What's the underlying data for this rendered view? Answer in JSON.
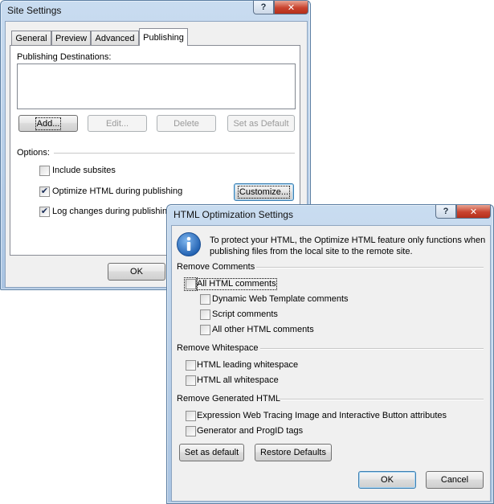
{
  "site_settings": {
    "title": "Site Settings",
    "help_glyph": "?",
    "close_glyph": "✕",
    "tabs": [
      "General",
      "Preview",
      "Advanced",
      "Publishing"
    ],
    "active_tab": "Publishing",
    "publishing_destinations_label": "Publishing Destinations:",
    "buttons": {
      "add": "Add...",
      "edit": "Edit...",
      "delete": "Delete",
      "set_as_default": "Set as Default"
    },
    "options_label": "Options:",
    "options": [
      {
        "label": "Include subsites",
        "checked": false
      },
      {
        "label": "Optimize HTML during publishing",
        "checked": true
      },
      {
        "label": "Log changes during publishing",
        "checked": true
      }
    ],
    "customize_label": "Customize...",
    "ok_label": "OK"
  },
  "html_opt": {
    "title": "HTML Optimization Settings",
    "help_glyph": "?",
    "close_glyph": "✕",
    "info_icon": "info-icon",
    "info_text_line1": "To protect your HTML, the Optimize HTML feature only functions when",
    "info_text_line2": "publishing files from the local site to the remote site.",
    "remove_comments_label": "Remove Comments",
    "comments": {
      "all": {
        "label": "All HTML comments",
        "checked": false
      },
      "dwt": {
        "label": "Dynamic Web Template comments",
        "checked": false
      },
      "script": {
        "label": "Script comments",
        "checked": false
      },
      "other": {
        "label": "All other HTML comments",
        "checked": false
      }
    },
    "remove_whitespace_label": "Remove Whitespace",
    "whitespace": {
      "leading": {
        "label": "HTML leading whitespace",
        "checked": false
      },
      "all": {
        "label": "HTML all whitespace",
        "checked": false
      }
    },
    "remove_generated_label": "Remove Generated HTML",
    "generated": {
      "tracing": {
        "label": "Expression Web Tracing Image and Interactive Button attributes",
        "checked": false
      },
      "progid": {
        "label": "Generator and ProgID tags",
        "checked": false
      }
    },
    "set_as_default_label": "Set as default",
    "restore_defaults_label": "Restore Defaults",
    "ok_label": "OK",
    "cancel_label": "Cancel"
  },
  "colors": {
    "title_bar": "#a9c4e2",
    "close_button": "#c8432e",
    "default_button_border": "#3c7fb1",
    "info_icon": "#1f5fb0"
  }
}
